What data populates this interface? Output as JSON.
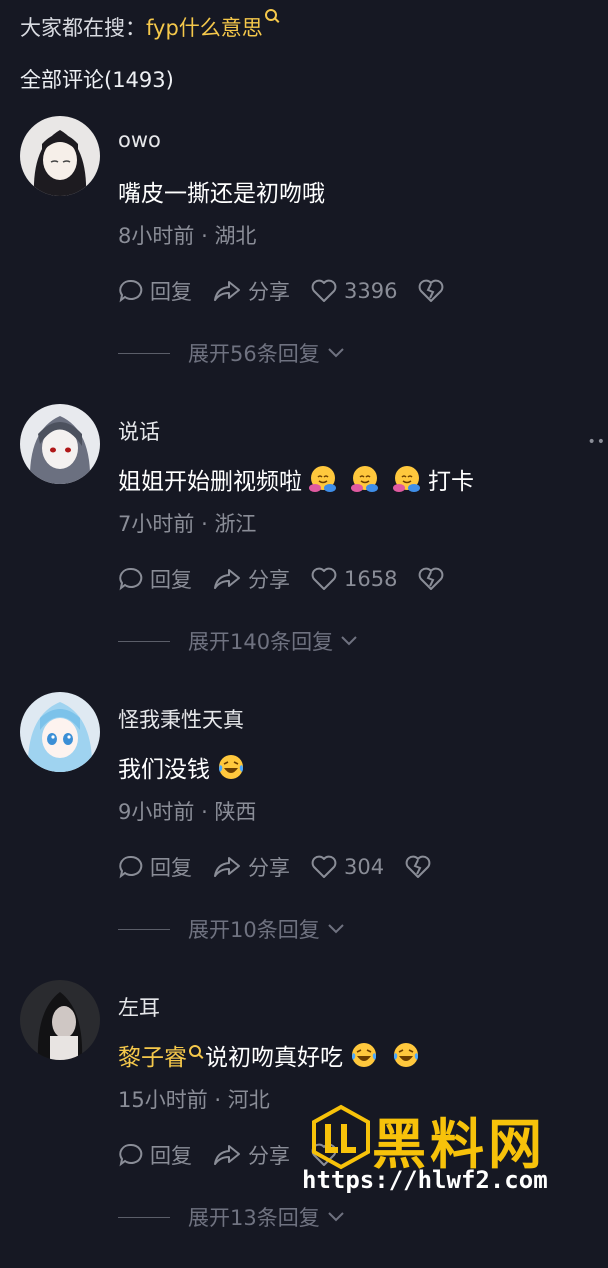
{
  "search_hint": {
    "prefix": "大家都在搜：",
    "keyword": "fyp什么意思"
  },
  "comments_total": "全部评论(1493)",
  "comments": [
    {
      "username": "owo",
      "text": "嘴皮一撕还是初吻哦",
      "time": "8小时前",
      "location": "湖北",
      "likes": "3396",
      "expand": "展开56条回复"
    },
    {
      "username": "说话",
      "text_before": "姐姐开始删视频啦",
      "text_after": "打卡",
      "time": "7小时前",
      "location": "浙江",
      "likes": "1658",
      "expand": "展开140条回复"
    },
    {
      "username": "怪我秉性天真",
      "text": "我们没钱",
      "time": "9小时前",
      "location": "陕西",
      "likes": "304",
      "expand": "展开10条回复"
    },
    {
      "username": "左耳",
      "mention": "黎子睿",
      "text": "说初吻真好吃",
      "time": "15小时前",
      "location": "河北",
      "expand": "展开13条回复"
    }
  ],
  "labels": {
    "reply": "回复",
    "share": "分享",
    "dot": "·"
  },
  "watermark": {
    "title": "黑料网",
    "url": "https://hlwf2.com"
  }
}
